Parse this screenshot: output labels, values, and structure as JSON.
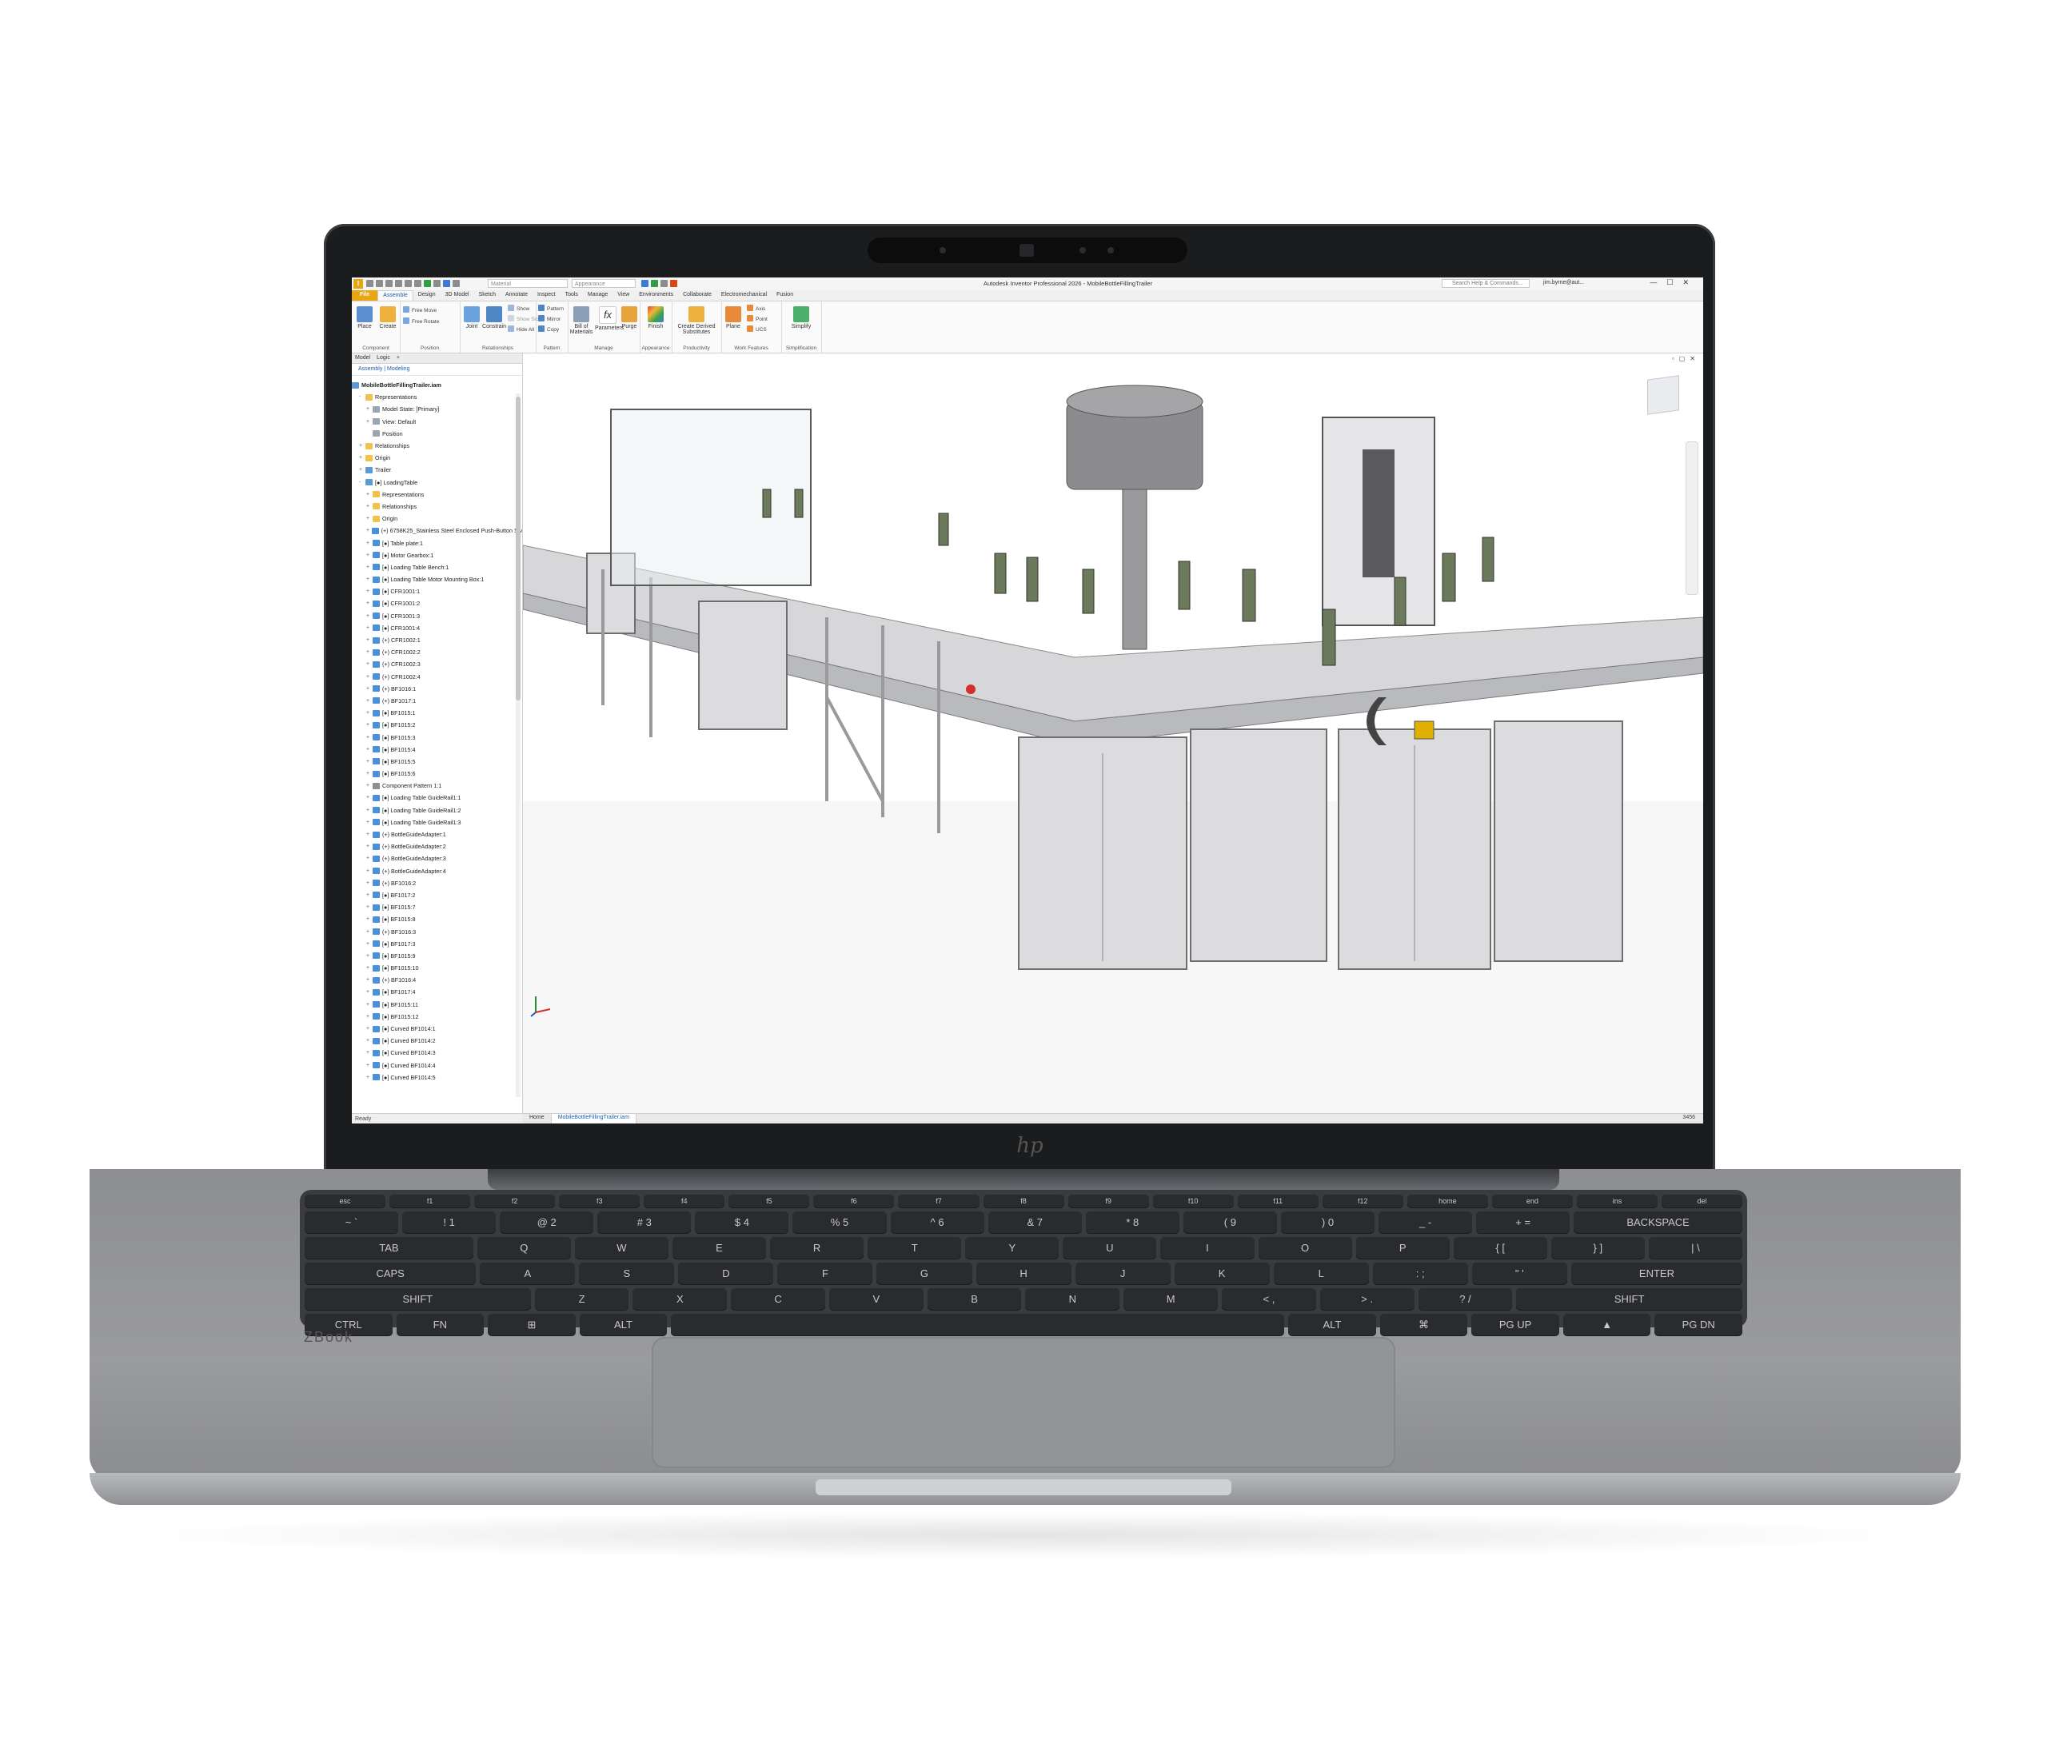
{
  "app": {
    "title": "Autodesk Inventor Professional 2026 - MobileBottleFillingTrailer",
    "logo": "I",
    "material_field": "Material",
    "appearance_field": "Appearance",
    "search_placeholder": "Search Help & Commands...",
    "user": "jim.byrne@aut...",
    "window_controls": "—☐✕"
  },
  "ribbon_tabs": [
    "File",
    "Assemble",
    "Design",
    "3D Model",
    "Sketch",
    "Annotate",
    "Inspect",
    "Tools",
    "Manage",
    "View",
    "Environments",
    "Collaborate",
    "Electromechanical",
    "Fusion"
  ],
  "ribbon": {
    "component": {
      "label": "Component",
      "place": "Place",
      "create": "Create"
    },
    "position": {
      "label": "Position",
      "free_move": "Free Move",
      "free_rotate": "Free Rotate"
    },
    "relationships": {
      "label": "Relationships",
      "joint": "Joint",
      "constrain": "Constrain",
      "show": "Show",
      "show_sick": "Show Sick",
      "hide_all": "Hide All"
    },
    "pattern": {
      "label": "Pattern",
      "pattern": "Pattern",
      "mirror": "Mirror",
      "copy": "Copy"
    },
    "manage": {
      "label": "Manage",
      "bom": "Bill of Materials",
      "parameters": "Parameters",
      "purge": "Purge"
    },
    "appearance": {
      "label": "Appearance",
      "finish": "Finish"
    },
    "productivity": {
      "label": "Productivity",
      "create_derived": "Create Derived Substitutes"
    },
    "work_features": {
      "label": "Work Features",
      "plane": "Plane",
      "axis": "Axis",
      "point": "Point",
      "ucs": "UCS"
    },
    "simplification": {
      "label": "Simplification",
      "simplify": "Simplify"
    }
  },
  "browser": {
    "tabs": [
      "Model",
      "Logic",
      "+"
    ],
    "modes": "Assembly | Modeling",
    "root": "MobileBottleFillingTrailer.iam",
    "items": [
      {
        "label": "Representations",
        "icon": "folder",
        "level": 1,
        "exp": "-"
      },
      {
        "label": "Model State: [Primary]",
        "icon": "view",
        "level": 2,
        "exp": "+"
      },
      {
        "label": "View: Default",
        "icon": "view",
        "level": 2,
        "exp": "+"
      },
      {
        "label": "Position",
        "icon": "view",
        "level": 2,
        "exp": ""
      },
      {
        "label": "Relationships",
        "icon": "folder",
        "level": 1,
        "exp": "+"
      },
      {
        "label": "Origin",
        "icon": "folder",
        "level": 1,
        "exp": "+"
      },
      {
        "label": "Trailer",
        "icon": "asm",
        "level": 1,
        "exp": "+"
      },
      {
        "label": "[●] LoadingTable",
        "icon": "asm",
        "level": 1,
        "exp": "-"
      },
      {
        "label": "Representations",
        "icon": "folder",
        "level": 2,
        "exp": "+"
      },
      {
        "label": "Relationships",
        "icon": "folder",
        "level": 2,
        "exp": "+"
      },
      {
        "label": "Origin",
        "icon": "folder",
        "level": 2,
        "exp": "+"
      },
      {
        "label": "(+) 6758K25_Stainless Steel Enclosed Push-Button Sw",
        "icon": "part",
        "level": 2,
        "exp": "+"
      },
      {
        "label": "[●] Table plate:1",
        "icon": "part",
        "level": 2,
        "exp": "+"
      },
      {
        "label": "[●] Motor Gearbox:1",
        "icon": "part",
        "level": 2,
        "exp": "+"
      },
      {
        "label": "[●] Loading Table Bench:1",
        "icon": "part",
        "level": 2,
        "exp": "+"
      },
      {
        "label": "[●] Loading Table Motor Mounting Box:1",
        "icon": "part",
        "level": 2,
        "exp": "+"
      },
      {
        "label": "[●] CFR1001:1",
        "icon": "part",
        "level": 2,
        "exp": "+"
      },
      {
        "label": "[●] CFR1001:2",
        "icon": "part",
        "level": 2,
        "exp": "+"
      },
      {
        "label": "[●] CFR1001:3",
        "icon": "part",
        "level": 2,
        "exp": "+"
      },
      {
        "label": "[●] CFR1001:4",
        "icon": "part",
        "level": 2,
        "exp": "+"
      },
      {
        "label": "(+) CFR1002:1",
        "icon": "part",
        "level": 2,
        "exp": "+"
      },
      {
        "label": "(+) CFR1002:2",
        "icon": "part",
        "level": 2,
        "exp": "+"
      },
      {
        "label": "(+) CFR1002:3",
        "icon": "part",
        "level": 2,
        "exp": "+"
      },
      {
        "label": "(+) CFR1002:4",
        "icon": "part",
        "level": 2,
        "exp": "+"
      },
      {
        "label": "(+) BF1016:1",
        "icon": "part",
        "level": 2,
        "exp": "+"
      },
      {
        "label": "(+) BF1017:1",
        "icon": "part",
        "level": 2,
        "exp": "+"
      },
      {
        "label": "[●] BF1015:1",
        "icon": "part",
        "level": 2,
        "exp": "+"
      },
      {
        "label": "[●] BF1015:2",
        "icon": "part",
        "level": 2,
        "exp": "+"
      },
      {
        "label": "[●] BF1015:3",
        "icon": "part",
        "level": 2,
        "exp": "+"
      },
      {
        "label": "[●] BF1015:4",
        "icon": "part",
        "level": 2,
        "exp": "+"
      },
      {
        "label": "[●] BF1015:5",
        "icon": "part",
        "level": 2,
        "exp": "+"
      },
      {
        "label": "[●] BF1015:6",
        "icon": "part",
        "level": 2,
        "exp": "+"
      },
      {
        "label": "Component Pattern 1:1",
        "icon": "pat",
        "level": 2,
        "exp": "+"
      },
      {
        "label": "[●] Loading Table GuideRail1:1",
        "icon": "part",
        "level": 2,
        "exp": "+"
      },
      {
        "label": "[●] Loading Table GuideRail1:2",
        "icon": "part",
        "level": 2,
        "exp": "+"
      },
      {
        "label": "[●] Loading Table GuideRail1:3",
        "icon": "part",
        "level": 2,
        "exp": "+"
      },
      {
        "label": "(+) BottleGuideAdapter:1",
        "icon": "part",
        "level": 2,
        "exp": "+"
      },
      {
        "label": "(+) BottleGuideAdapter:2",
        "icon": "part",
        "level": 2,
        "exp": "+"
      },
      {
        "label": "(+) BottleGuideAdapter:3",
        "icon": "part",
        "level": 2,
        "exp": "+"
      },
      {
        "label": "(+) BottleGuideAdapter:4",
        "icon": "part",
        "level": 2,
        "exp": "+"
      },
      {
        "label": "(+) BF1016:2",
        "icon": "part",
        "level": 2,
        "exp": "+"
      },
      {
        "label": "[●] BF1017:2",
        "icon": "part",
        "level": 2,
        "exp": "+"
      },
      {
        "label": "[●] BF1015:7",
        "icon": "part",
        "level": 2,
        "exp": "+"
      },
      {
        "label": "[●] BF1015:8",
        "icon": "part",
        "level": 2,
        "exp": "+"
      },
      {
        "label": "(+) BF1016:3",
        "icon": "part",
        "level": 2,
        "exp": "+"
      },
      {
        "label": "[●] BF1017:3",
        "icon": "part",
        "level": 2,
        "exp": "+"
      },
      {
        "label": "[●] BF1015:9",
        "icon": "part",
        "level": 2,
        "exp": "+"
      },
      {
        "label": "[●] BF1015:10",
        "icon": "part",
        "level": 2,
        "exp": "+"
      },
      {
        "label": "(+) BF1016:4",
        "icon": "part",
        "level": 2,
        "exp": "+"
      },
      {
        "label": "[●] BF1017:4",
        "icon": "part",
        "level": 2,
        "exp": "+"
      },
      {
        "label": "[●] BF1015:11",
        "icon": "part",
        "level": 2,
        "exp": "+"
      },
      {
        "label": "[●] BF1015:12",
        "icon": "part",
        "level": 2,
        "exp": "+"
      },
      {
        "label": "[●] Curved BF1014:1",
        "icon": "part",
        "level": 2,
        "exp": "+"
      },
      {
        "label": "[●] Curved BF1014:2",
        "icon": "part",
        "level": 2,
        "exp": "+"
      },
      {
        "label": "[●] Curved BF1014:3",
        "icon": "part",
        "level": 2,
        "exp": "+"
      },
      {
        "label": "[●] Curved BF1014:4",
        "icon": "part",
        "level": 2,
        "exp": "+"
      },
      {
        "label": "[●] Curved BF1014:5",
        "icon": "part",
        "level": 2,
        "exp": "+"
      }
    ]
  },
  "doc_tabs": [
    "Home",
    "MobileBottleFillingTrailer.iam"
  ],
  "status": {
    "text": "Ready",
    "number": "3456"
  },
  "hardware": {
    "brand_logo": "hp",
    "model": "ZBook",
    "keys": {
      "fn": [
        "esc",
        "f1",
        "f2",
        "f3",
        "f4",
        "f5",
        "f6",
        "f7",
        "f8",
        "f9",
        "f10",
        "f11",
        "f12",
        "home",
        "end",
        "ins",
        "del"
      ],
      "num": [
        "~ `",
        "! 1",
        "@ 2",
        "# 3",
        "$ 4",
        "% 5",
        "^ 6",
        "& 7",
        "* 8",
        "( 9",
        ") 0",
        "_ -",
        "+ =",
        "BACKSPACE"
      ],
      "qwerty": [
        "TAB",
        "Q",
        "W",
        "E",
        "R",
        "T",
        "Y",
        "U",
        "I",
        "O",
        "P",
        "{ [",
        "} ]",
        "| \\"
      ],
      "home": [
        "CAPS",
        "A",
        "S",
        "D",
        "F",
        "G",
        "H",
        "J",
        "K",
        "L",
        ": ;",
        "\" '",
        "ENTER"
      ],
      "shift": [
        "SHIFT",
        "Z",
        "X",
        "C",
        "V",
        "B",
        "N",
        "M",
        "< ,",
        "> .",
        "? /",
        "SHIFT"
      ],
      "bottom": [
        "CTRL",
        "FN",
        "⊞",
        "ALT",
        "",
        "ALT",
        "⌘",
        "PG UP",
        "▲",
        "PG DN"
      ]
    }
  }
}
